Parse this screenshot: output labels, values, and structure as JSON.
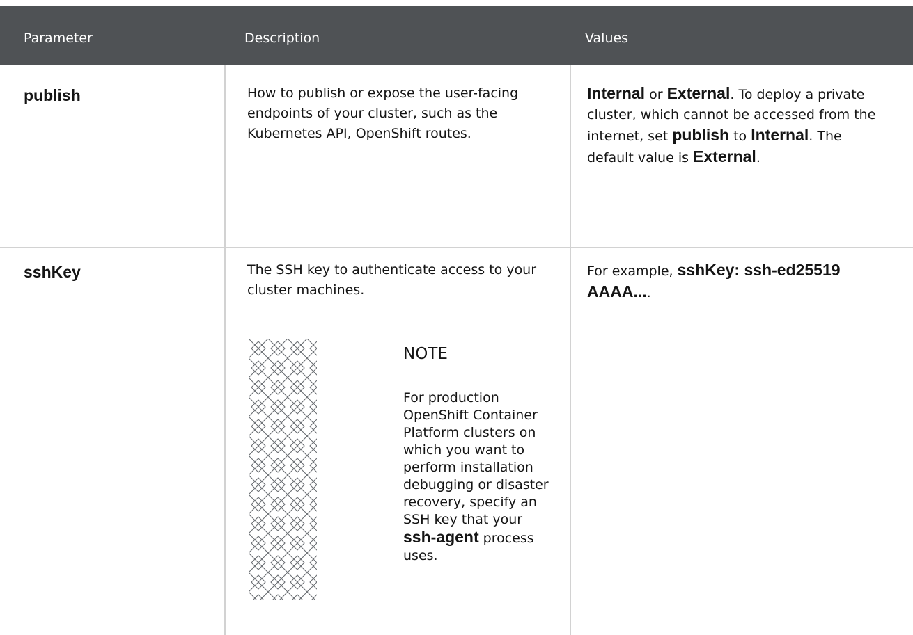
{
  "table": {
    "headers": {
      "parameter": "Parameter",
      "description": "Description",
      "values": "Values"
    },
    "rows": [
      {
        "parameter": "publish",
        "description": "How to publish or expose the user-facing endpoints of your cluster, such as the Kubernetes API, OpenShift routes.",
        "values": {
          "internal_1": "Internal",
          "or": " or ",
          "external_1": "External",
          "text_1": ". To deploy a private cluster, which cannot be accessed from the internet, set ",
          "publish": "publish",
          "to": " to ",
          "internal_2": "Internal",
          "text_2": ". The default value is ",
          "external_2": "External",
          "end": "."
        }
      },
      {
        "parameter": "sshKey",
        "description": "The SSH key to authenticate access to your cluster machines.",
        "values": {
          "prefix": "For example, ",
          "code": "sshKey: ssh-ed25519 AAAA...",
          "end": "."
        },
        "note": {
          "icon": "note-pattern-icon",
          "title": "NOTE",
          "text_1": "For production OpenShift Container Platform clusters on which you want to perform installation debugging or disaster recovery, specify an SSH key that your ",
          "code": "ssh-agent",
          "text_2": " process uses."
        }
      }
    ]
  }
}
